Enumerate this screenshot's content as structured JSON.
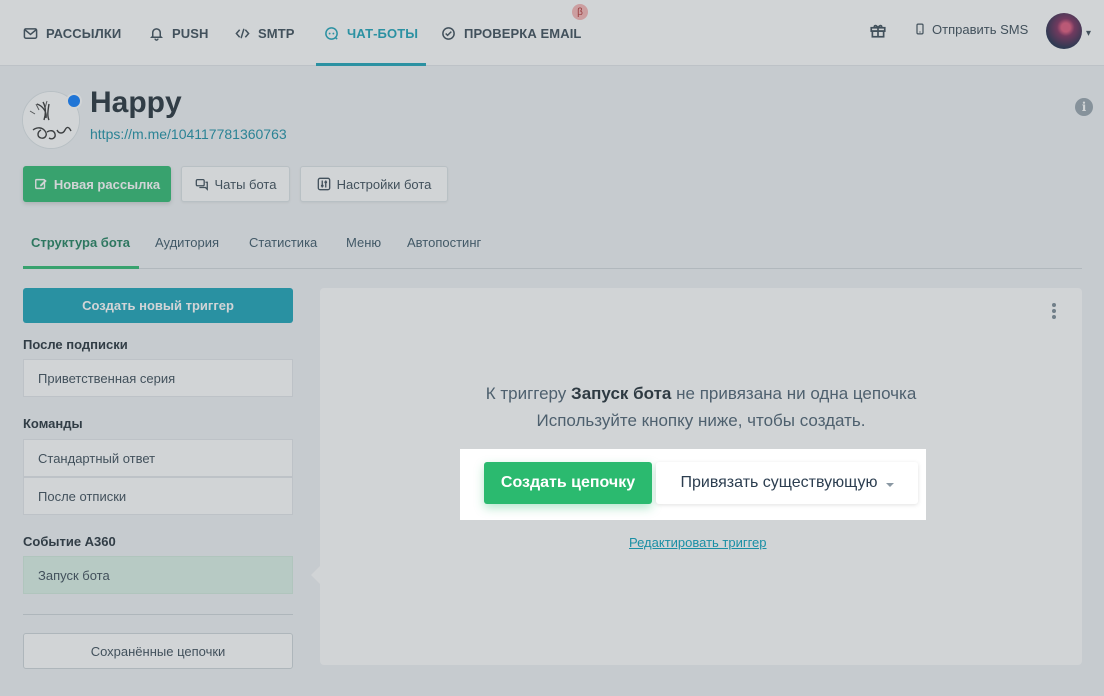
{
  "topnav": {
    "items": [
      {
        "label": "РАССЫЛКИ",
        "icon": "envelope-icon"
      },
      {
        "label": "PUSH",
        "icon": "bell-icon"
      },
      {
        "label": "SMTP",
        "icon": "code-icon"
      },
      {
        "label": "ЧАТ-БОТЫ",
        "icon": "chat-bot-icon",
        "active": true
      },
      {
        "label": "ПРОВЕРКА EMAIL",
        "icon": "check-circle-icon"
      }
    ],
    "beta_badge": "β",
    "sms_label": "Отправить SMS",
    "accent_color": "#1aa3b8"
  },
  "bot": {
    "name": "Happy",
    "link": "https://m.me/104117781360763"
  },
  "actions": {
    "new_campaign": "Новая рассылка",
    "bot_chats": "Чаты бота",
    "bot_settings": "Настройки бота"
  },
  "tabs": [
    {
      "label": "Структура бота",
      "active": true
    },
    {
      "label": "Аудитория"
    },
    {
      "label": "Статистика"
    },
    {
      "label": "Меню"
    },
    {
      "label": "Автопостинг"
    }
  ],
  "sidebar": {
    "create_trigger": "Создать новый триггер",
    "groups": [
      {
        "heading": "После подписки",
        "items": [
          "Приветственная серия"
        ]
      },
      {
        "heading": "Команды",
        "items": [
          "Стандартный ответ",
          "После отписки"
        ]
      },
      {
        "heading": "Событие А360",
        "items": [
          "Запуск бота"
        ]
      }
    ],
    "saved_chains": "Сохранённые цепочки"
  },
  "main": {
    "empty_prefix": "К триггеру",
    "trigger_name": "Запуск бота",
    "empty_suffix": "не привязана ни одна цепочка",
    "empty_line2": "Используйте кнопку ниже, чтобы создать.",
    "create_chain": "Создать цепочку",
    "bind_existing": "Привязать существующую",
    "edit_trigger": "Редактировать триггер"
  },
  "colors": {
    "green": "#2bba6f",
    "teal": "#17a2b8",
    "active_item_bg": "#dcf1e7"
  }
}
